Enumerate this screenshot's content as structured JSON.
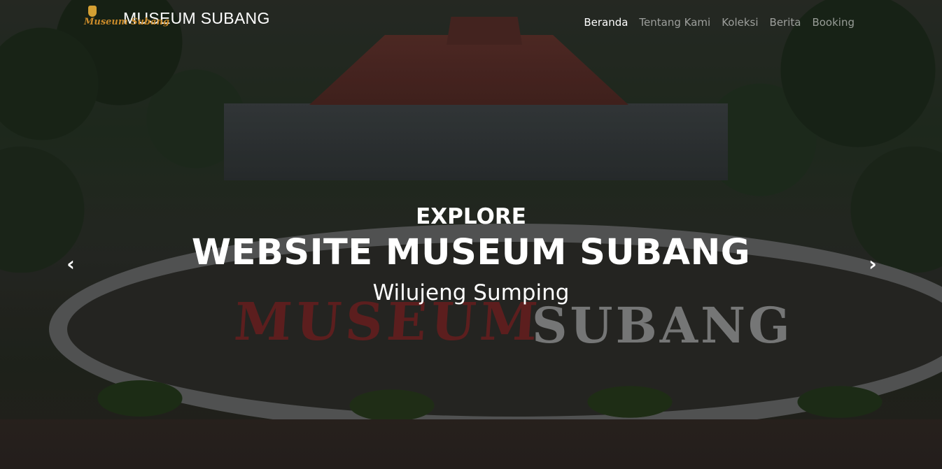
{
  "brand": {
    "logo_text": "Museum Subang",
    "name": "MUSEUM SUBANG"
  },
  "nav": {
    "items": [
      {
        "label": "Beranda",
        "active": true
      },
      {
        "label": "Tentang Kami",
        "active": false
      },
      {
        "label": "Koleksi",
        "active": false
      },
      {
        "label": "Berita",
        "active": false
      },
      {
        "label": "Booking",
        "active": false
      }
    ]
  },
  "hero": {
    "kicker": "EXPLORE",
    "title": "WEBSITE MUSEUM SUBANG",
    "subtitle": "Wilujeng Sumping",
    "sign_museum": "MUSEUM",
    "sign_subang": "SUBANG",
    "prev_icon": "‹",
    "next_icon": "›"
  },
  "colors": {
    "text": "#ffffff",
    "nav_inactive": "rgba(255,255,255,0.55)",
    "logo_gold": "#c98a2a"
  }
}
